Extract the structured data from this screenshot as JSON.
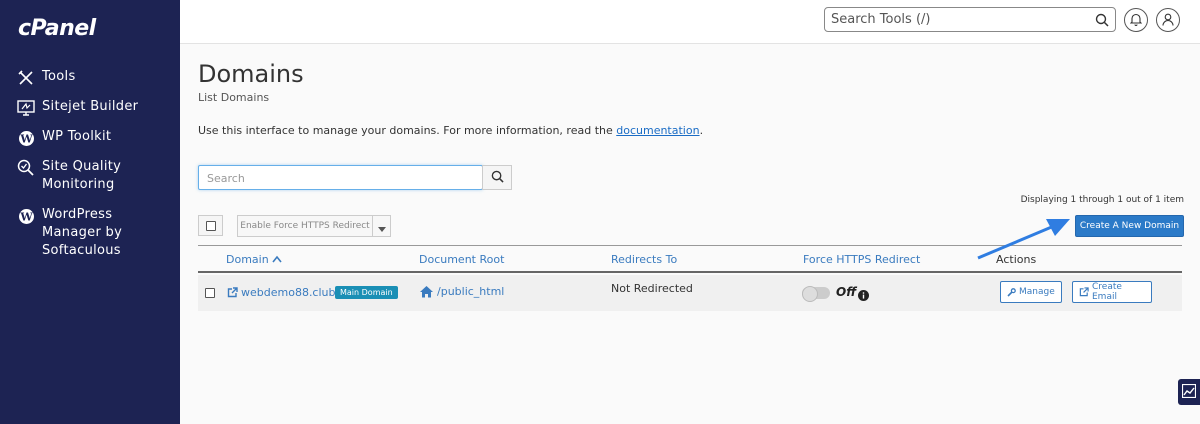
{
  "brand": {
    "logo_text": "cPanel"
  },
  "sidebar": {
    "items": [
      {
        "label": "Tools",
        "icon": "tools-icon"
      },
      {
        "label": "Sitejet Builder",
        "icon": "sitejet-icon"
      },
      {
        "label": "WP Toolkit",
        "icon": "wordpress-icon"
      },
      {
        "label": "Site Quality Monitoring",
        "icon": "site-quality-icon"
      },
      {
        "label": "WordPress Manager by Softaculous",
        "icon": "wordpress-icon"
      }
    ]
  },
  "topbar": {
    "search_placeholder": "Search Tools (/)"
  },
  "page": {
    "title": "Domains",
    "subtitle": "List Domains",
    "intro_text": "Use this interface to manage your domains. For more information, read the ",
    "intro_link": "documentation",
    "intro_end": "."
  },
  "toolbar": {
    "search_placeholder": "Search",
    "https_button": "Enable Force HTTPS Redirect",
    "create_button": "Create A New Domain",
    "displaying": "Displaying 1 through 1 out of 1 item"
  },
  "table": {
    "headers": {
      "domain": "Domain",
      "docroot": "Document Root",
      "redirects": "Redirects To",
      "https": "Force HTTPS Redirect",
      "actions": "Actions"
    },
    "rows": [
      {
        "domain": "webdemo88.club",
        "badge": "Main Domain",
        "docroot": "/public_html",
        "redirect": "Not Redirected",
        "https_state": "Off",
        "manage": "Manage",
        "create_email": "Create Email"
      }
    ]
  },
  "colors": {
    "sidebar": "#1d2353",
    "accent": "#2b7ac8",
    "link": "#3a7bbf",
    "badge": "#1a8fb5"
  }
}
